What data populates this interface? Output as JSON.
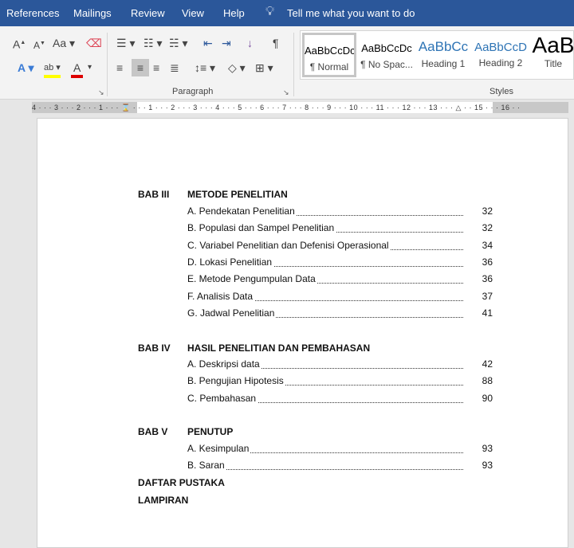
{
  "tabs": [
    "References",
    "Mailings",
    "Review",
    "View",
    "Help"
  ],
  "tell_me": "Tell me what you want to do",
  "ribbon": {
    "paragraph_label": "Paragraph",
    "styles_label": "Styles",
    "styles": [
      {
        "preview": "AaBbCcDc",
        "name": "¶ Normal",
        "selected": true
      },
      {
        "preview": "AaBbCcDc",
        "name": "¶ No Spac..."
      },
      {
        "preview": "AaBbCc",
        "name": "Heading 1"
      },
      {
        "preview": "AaBbCcD",
        "name": "Heading 2"
      },
      {
        "preview": "AaB",
        "name": "Title"
      }
    ],
    "font_case": "Aa"
  },
  "ruler": "4 · · · 3 · · · 2 · · · 1 · · · ⌛ · · · 1 · · · 2 · · · 3 · · · 4 · · · 5 · · · 6 · · · 7 · · · 8 · · · 9 · · · 10 · · · 11 · · · 12 · · · 13 · · · △ · · 15 · · · 16 · ·",
  "toc": {
    "bab3": {
      "num": "BAB III",
      "title": "METODE PENELITIAN",
      "items": [
        {
          "label": "A. Pendekatan Penelitian",
          "page": "32"
        },
        {
          "label": "B. Populasi dan Sampel Penelitian",
          "page": "32"
        },
        {
          "label": "C. Variabel Penelitian dan Defenisi Operasional",
          "page": "34"
        },
        {
          "label": "D. Lokasi Penelitian",
          "page": "36"
        },
        {
          "label": "E. Metode Pengumpulan Data",
          "page": "36"
        },
        {
          "label": "F. Analisis Data",
          "page": "37"
        },
        {
          "label": "G. Jadwal Penelitian",
          "page": "41"
        }
      ]
    },
    "bab4": {
      "num": "BAB IV",
      "title": "HASIL PENELITIAN DAN PEMBAHASAN",
      "items": [
        {
          "label": "A. Deskripsi data",
          "page": "42"
        },
        {
          "label": "B. Pengujian Hipotesis",
          "page": "88"
        },
        {
          "label": "C. Pembahasan",
          "page": "90"
        }
      ]
    },
    "bab5": {
      "num": "BAB V",
      "title": "PENUTUP",
      "items": [
        {
          "label": "A. Kesimpulan",
          "page": "93"
        },
        {
          "label": "B. Saran",
          "page": "93"
        }
      ]
    },
    "daftar": "DAFTAR PUSTAKA",
    "lampiran": "LAMPIRAN"
  }
}
